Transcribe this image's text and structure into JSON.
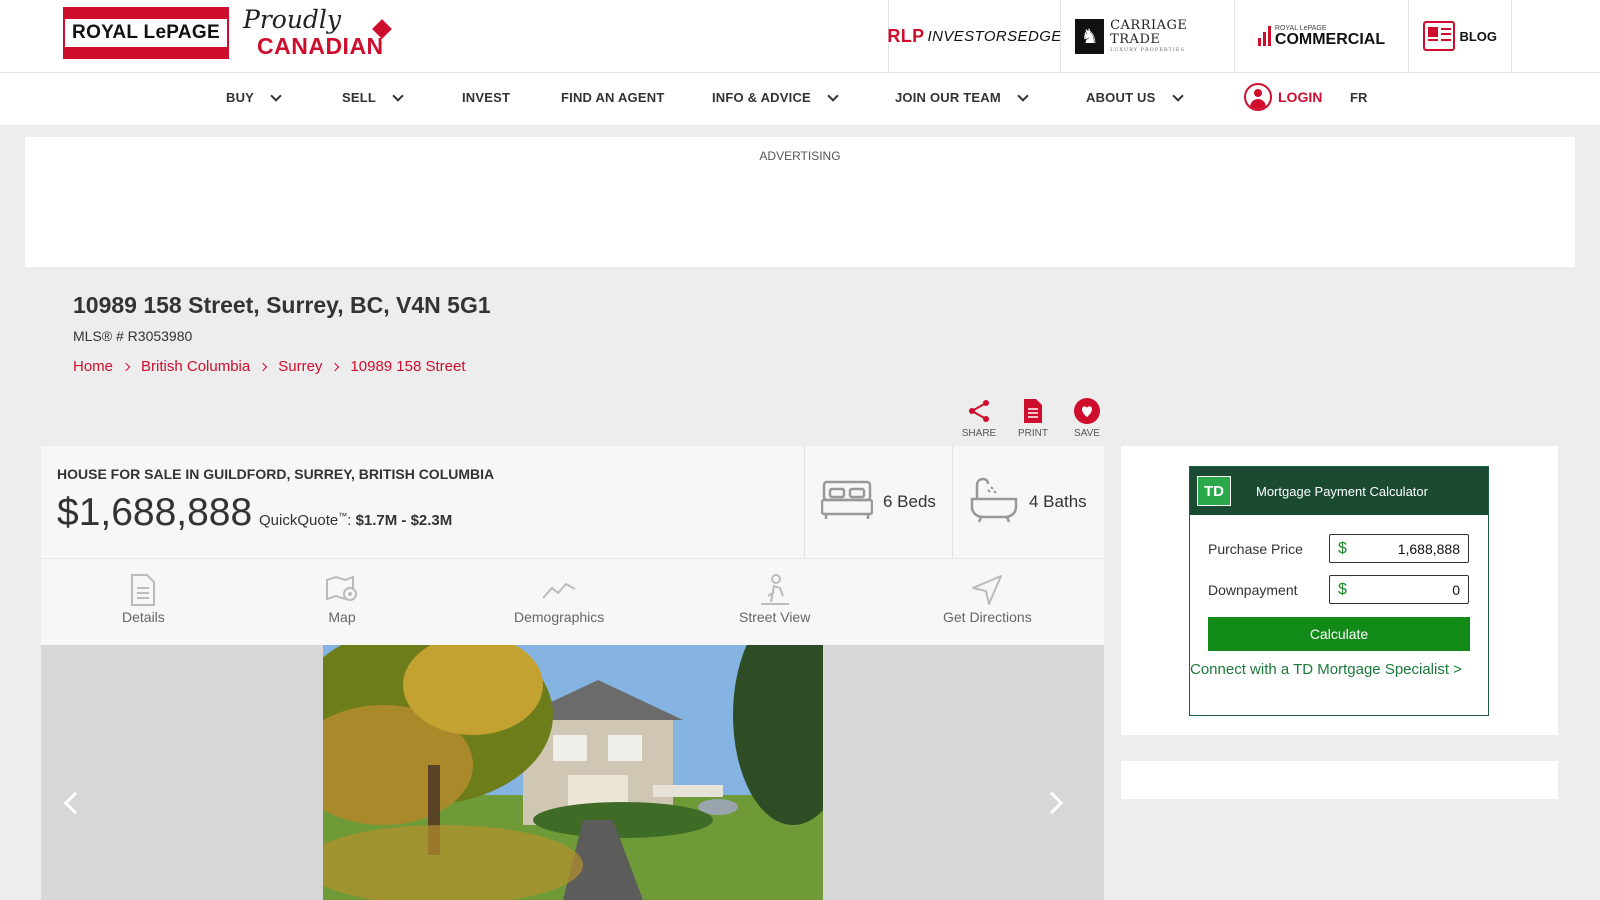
{
  "header": {
    "brand_logo_text": "ROYAL LePAGE",
    "proudly_text": "Proudly",
    "canadian_text": "CANADIAN",
    "partners": {
      "investorsedge": "INVESTORSEDGE",
      "investorsedge_mark": "RLP",
      "carriage_trade": "CARRIAGE TRADE",
      "carriage_trade_sub": "LUXURY PROPERTIES",
      "commercial": "COMMERCIAL",
      "commercial_sub": "ROYAL LePAGE",
      "blog": "BLOG"
    }
  },
  "nav": {
    "buy": "BUY",
    "sell": "SELL",
    "invest": "INVEST",
    "find_agent": "FIND AN AGENT",
    "info_advice": "INFO & ADVICE",
    "join_team": "JOIN OUR TEAM",
    "about_us": "ABOUT US",
    "login": "LOGIN",
    "fr": "FR"
  },
  "ad": {
    "label": "ADVERTISING"
  },
  "listing": {
    "address": "10989 158 Street, Surrey, BC, V4N 5G1",
    "mls": "MLS® # R3053980",
    "breadcrumbs": [
      "Home",
      "British Columbia",
      "Surrey",
      "10989 158 Street"
    ],
    "actions": {
      "share": "SHARE",
      "print": "PRINT",
      "save": "SAVE"
    },
    "property_type": "HOUSE FOR SALE IN GUILDFORD, SURREY, BRITISH COLUMBIA",
    "price": "$1,688,888",
    "quickquote_label": "QuickQuote",
    "quickquote_tm": "™",
    "quickquote_value": "$1.7M - $2.3M",
    "beds": "6 Beds",
    "baths": "4 Baths",
    "tabs": [
      "Details",
      "Map",
      "Demographics",
      "Street View",
      "Get Directions"
    ]
  },
  "mortgage_calculator": {
    "logo": "TD",
    "title": "Mortgage Payment Calculator",
    "purchase_price_label": "Purchase Price",
    "purchase_price_value": "1,688,888",
    "downpayment_label": "Downpayment",
    "downpayment_value": "0",
    "currency": "$",
    "calculate_label": "Calculate",
    "connect_link": "Connect with a TD Mortgage Specialist >"
  },
  "colors": {
    "brand_red": "#cf0e2e",
    "td_green": "#1a4b32",
    "button_green": "#118a18"
  }
}
